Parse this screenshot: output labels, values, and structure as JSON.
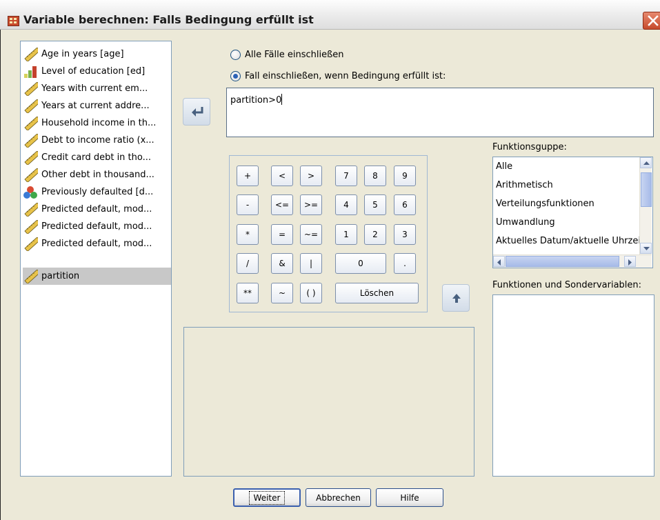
{
  "window": {
    "title": "Variable berechnen: Falls Bedingung erfüllt ist",
    "close_icon": "close-x-icon"
  },
  "variables": [
    {
      "label": "Age in years [age]",
      "icon": "ruler-scale-icon"
    },
    {
      "label": "Level of education [ed]",
      "icon": "ordinal-bars-icon"
    },
    {
      "label": "Years with current em...",
      "icon": "ruler-scale-icon"
    },
    {
      "label": "Years at current addre...",
      "icon": "ruler-scale-icon"
    },
    {
      "label": "Household income in th...",
      "icon": "ruler-scale-icon"
    },
    {
      "label": "Debt to income ratio (x...",
      "icon": "ruler-scale-icon"
    },
    {
      "label": "Credit card debt in tho...",
      "icon": "ruler-scale-icon"
    },
    {
      "label": "Other debt in thousand...",
      "icon": "ruler-scale-icon"
    },
    {
      "label": "Previously defaulted [d...",
      "icon": "nominal-circles-icon"
    },
    {
      "label": "Predicted default, mod...",
      "icon": "ruler-scale-icon"
    },
    {
      "label": "Predicted default, mod...",
      "icon": "ruler-scale-icon"
    },
    {
      "label": "Predicted default, mod...",
      "icon": "ruler-scale-icon"
    },
    {
      "label": "partition",
      "icon": "ruler-scale-icon",
      "selected": true
    }
  ],
  "options": {
    "all_cases": {
      "label": "Alle Fälle einschließen",
      "checked": false
    },
    "if_condition": {
      "label": "Fall einschließen, wenn Bedingung erfüllt ist:",
      "checked": true
    }
  },
  "expression": {
    "value": "partition>0"
  },
  "keypad": {
    "keys": [
      "+",
      "<",
      ">",
      "7",
      "8",
      "9",
      "-",
      "<=",
      ">=",
      "4",
      "5",
      "6",
      "*",
      "=",
      "~=",
      "1",
      "2",
      "3",
      "/",
      "&",
      "|",
      "0",
      ".",
      "**",
      "~",
      "( )",
      "Löschen"
    ]
  },
  "function_group": {
    "label": "Funktionsguppe:",
    "items": [
      "Alle",
      "Arithmetisch",
      "Verteilungsfunktionen",
      "Umwandlung",
      "Aktuelles Datum/aktuelle Uhrzeit"
    ]
  },
  "functions": {
    "label": "Funktionen und Sondervariablen:"
  },
  "buttons": {
    "continue": "Weiter",
    "cancel": "Abbrechen",
    "help": "Hilfe"
  },
  "colors": {
    "selection": "#c8c8c8",
    "title_close": "#c64a2c",
    "radio_dot": "#2c62b6"
  }
}
